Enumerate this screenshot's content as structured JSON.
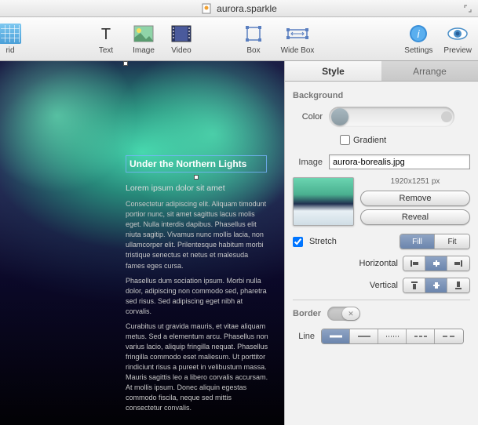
{
  "title": "aurora.sparkle",
  "toolbar": {
    "grid": "rid",
    "text": "Text",
    "image": "Image",
    "video": "Video",
    "box": "Box",
    "widebox": "Wide Box",
    "settings": "Settings",
    "preview": "Preview"
  },
  "canvas": {
    "text_heading": "Under the Northern Lights",
    "lorem1": "Lorem ipsum dolor sit amet",
    "lorem2": "Curabitus ut gravida mauris, et vitae aliquam metus. Sed a elementum arcu. Phasellus non varius lacio, aliquip fringilla nequat. Phasellus fringilla commodo eset maliesum. Ut porttitor rindiciunt risus a pureet in velibustum massa. Mauris sagittis leo a libero corvalis accursam. At mollis ipsum. Donec aliquin egestas commodo fiscila, neque sed mittis consectetur convalis."
  },
  "inspector": {
    "tabs": {
      "style": "Style",
      "arrange": "Arrange"
    },
    "background": {
      "header": "Background",
      "color_label": "Color",
      "gradient_label": "Gradient",
      "image_label": "Image",
      "image_value": "aurora-borealis.jpg",
      "dimensions": "1920x1251 px",
      "remove": "Remove",
      "reveal": "Reveal",
      "stretch": "Stretch",
      "fill": "Fill",
      "fit": "Fit",
      "horizontal": "Horizontal",
      "vertical": "Vertical"
    },
    "border": {
      "header": "Border",
      "line": "Line"
    }
  }
}
